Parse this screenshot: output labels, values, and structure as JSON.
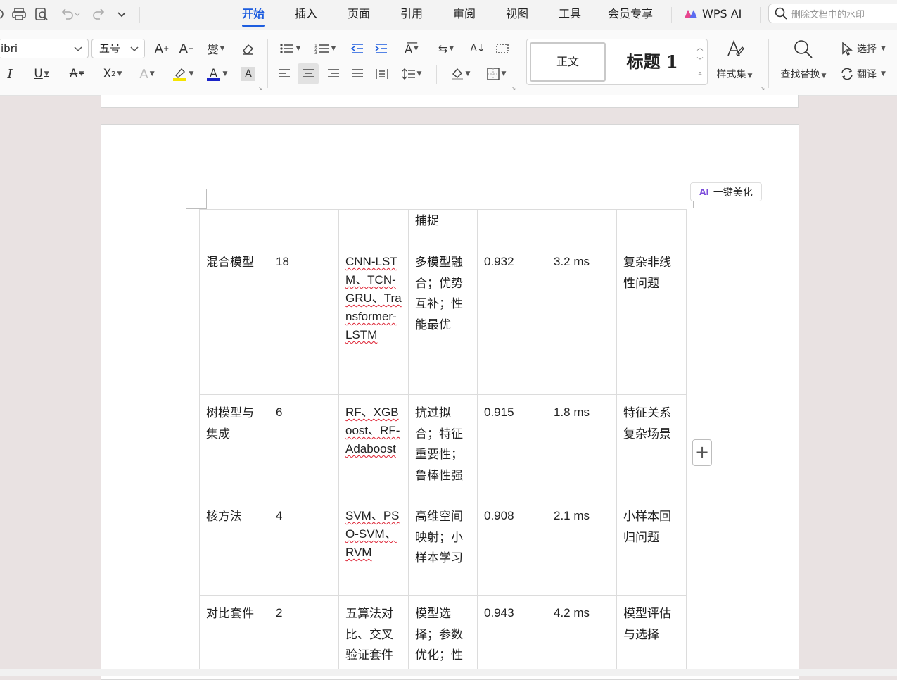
{
  "menu": {
    "tabs": [
      {
        "label": "开始",
        "active": true
      },
      {
        "label": "插入"
      },
      {
        "label": "页面"
      },
      {
        "label": "引用"
      },
      {
        "label": "审阅"
      },
      {
        "label": "视图"
      },
      {
        "label": "工具"
      },
      {
        "label": "会员专享"
      }
    ],
    "wps_ai_label": "WPS AI",
    "search_placeholder": "删除文档中的水印"
  },
  "ribbon": {
    "font_name": "ibri",
    "font_size": "五号",
    "style_normal": "正文",
    "style_heading": "标题 1",
    "style_set_label": "样式集",
    "find_replace_label": "查找替换",
    "select_label": "选择",
    "translate_label": "翻译"
  },
  "document": {
    "ai_beautify_badge": "AI",
    "ai_beautify_label": "一键美化",
    "table": {
      "rows": [
        {
          "c1": "",
          "c2": "",
          "c3": "",
          "c4": "捕捉",
          "c5": "",
          "c6": "",
          "c7": ""
        },
        {
          "c1": "混合模型",
          "c2": "18",
          "c3": "CNN-LSTM、TCN-GRU、Transformer-LSTM",
          "c4": "多模型融合；优势互补；性能最优",
          "c5": "0.932",
          "c6": "3.2 ms",
          "c7": "复杂非线性问题"
        },
        {
          "c1": "树模型与集成",
          "c2": "6",
          "c3": "RF、XGBoost、RF-Adaboost",
          "c4": "抗过拟合；特征重要性；鲁棒性强",
          "c5": "0.915",
          "c6": "1.8 ms",
          "c7": "特征关系复杂场景"
        },
        {
          "c1": "核方法",
          "c2": "4",
          "c3": "SVM、PSO-SVM、RVM",
          "c4": "高维空间映射；小样本学习",
          "c5": "0.908",
          "c6": "2.1 ms",
          "c7": "小样本回归问题"
        },
        {
          "c1": "对比套件",
          "c2": "2",
          "c3": "五算法对比、交叉验证套件",
          "c4": "模型选择；参数优化；性",
          "c5": "0.943",
          "c6": "4.2 ms",
          "c7": "模型评估与选择"
        }
      ]
    }
  },
  "colors": {
    "accent": "#1d5ddf",
    "spellcheck": "#dd2233"
  }
}
